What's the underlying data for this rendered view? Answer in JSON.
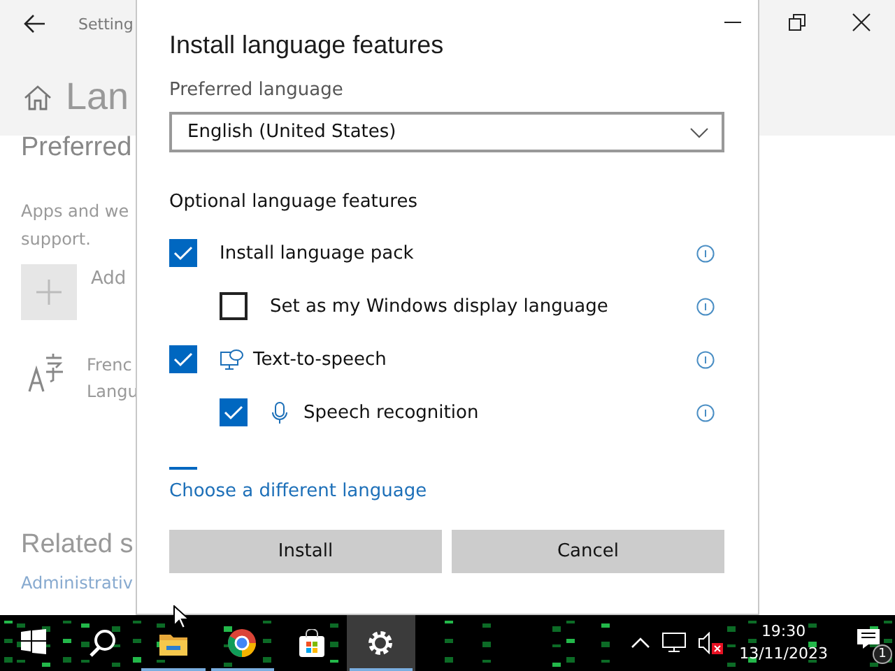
{
  "settings_window": {
    "title": "Setting",
    "page_title": "Lan",
    "section_title": "Preferred",
    "description_lines": [
      "Apps and we",
      "support."
    ],
    "add_label": "Add",
    "language": {
      "name": "Frenc",
      "status": "Langu"
    },
    "related_title": "Related s",
    "related_link": "Administrativ"
  },
  "dialog": {
    "title": "Install language features",
    "preferred_label": "Preferred language",
    "dropdown_value": "English (United States)",
    "features_label": "Optional language features",
    "features": [
      {
        "label": "Install language pack",
        "checked": true,
        "kind": "plain",
        "children": [
          {
            "label": "Set as my Windows display language",
            "checked": false,
            "kind": "plain"
          }
        ]
      },
      {
        "label": "Text-to-speech",
        "checked": true,
        "kind": "speech",
        "children": [
          {
            "label": "Speech recognition",
            "checked": true,
            "kind": "microphone"
          }
        ]
      }
    ],
    "link": "Choose a different language",
    "buttons": [
      "Install",
      "Cancel"
    ]
  },
  "taskbar": {
    "apps": [
      {
        "kind": "start",
        "running": false,
        "active": false
      },
      {
        "kind": "search",
        "running": false,
        "active": false
      },
      {
        "kind": "explorer",
        "running": true,
        "active": false
      },
      {
        "kind": "chrome",
        "running": true,
        "active": false
      },
      {
        "kind": "store",
        "running": false,
        "active": false
      },
      {
        "kind": "settings",
        "running": true,
        "active": true
      }
    ],
    "time": "19:30",
    "date": "13/11/2023",
    "notification_count": "1"
  }
}
